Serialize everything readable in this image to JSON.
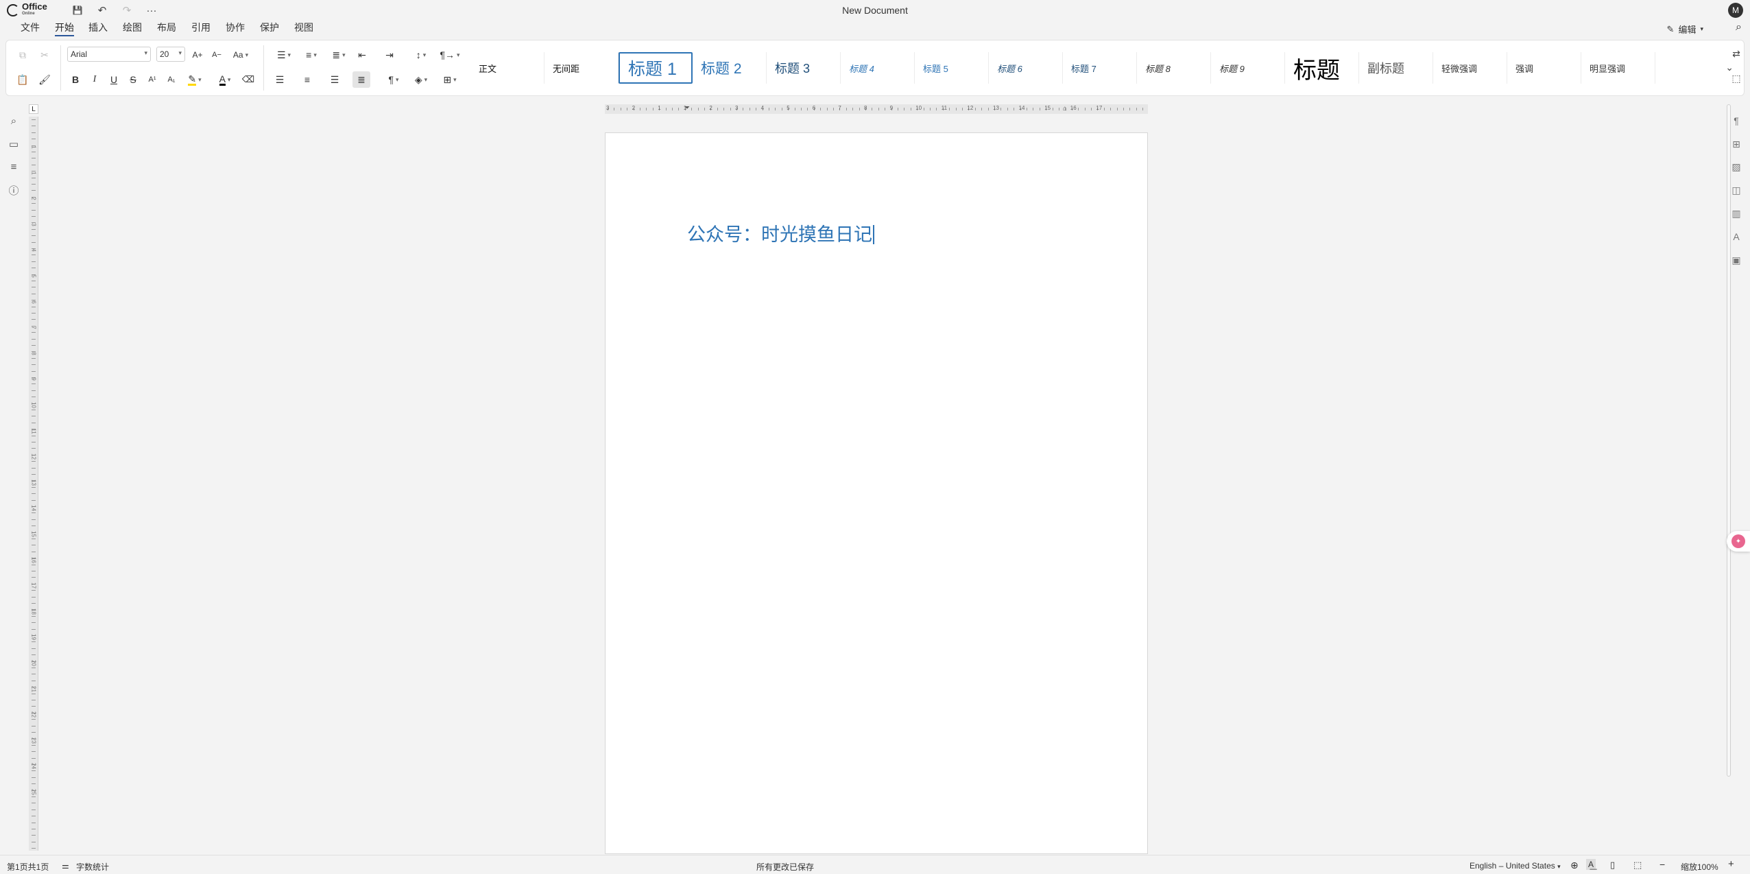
{
  "app": {
    "logo": "Office",
    "logo_sub": "Online",
    "doc_title": "New Document",
    "avatar": "M"
  },
  "quick": {
    "save": "💾",
    "undo": "↶",
    "redo": "↷",
    "more": "···"
  },
  "menu": {
    "items": [
      "文件",
      "开始",
      "插入",
      "绘图",
      "布局",
      "引用",
      "协作",
      "保护",
      "视图"
    ],
    "active": 1,
    "edit_mode": "编辑",
    "edit_icon": "✎",
    "search_icon": "⌕"
  },
  "ribbon": {
    "font_name": "Arial",
    "font_size": "20",
    "grow": "A+",
    "shrink": "A−",
    "case": "Aa",
    "bold": "B",
    "italic": "I",
    "underline": "U",
    "strike": "S",
    "superscript": "A¹",
    "subscript": "A₁",
    "highlight": "✎",
    "font_color": "A",
    "eraser": "⌫",
    "para_mark": "¶",
    "highlight_color": "#ffd800",
    "font_color_bar": "#000000"
  },
  "styles": [
    {
      "label": "正文",
      "cls": "st-normal"
    },
    {
      "label": "无间距",
      "cls": "st-normal"
    },
    {
      "label": "标题 1",
      "cls": "st-h1"
    },
    {
      "label": "标题 2",
      "cls": "st-h2"
    },
    {
      "label": "标题 3",
      "cls": "st-h3"
    },
    {
      "label": "标题 4",
      "cls": "st-h4"
    },
    {
      "label": "标题 5",
      "cls": "st-h5"
    },
    {
      "label": "标题 6",
      "cls": "st-h6"
    },
    {
      "label": "标题 7",
      "cls": "st-h7"
    },
    {
      "label": "标题 8",
      "cls": "st-h8"
    },
    {
      "label": "标题 9",
      "cls": "st-h9"
    },
    {
      "label": "标题",
      "cls": "st-title"
    },
    {
      "label": "副标题",
      "cls": "st-sub"
    },
    {
      "label": "轻微强调",
      "cls": "st-emph"
    },
    {
      "label": "强调",
      "cls": "st-emph"
    },
    {
      "label": "明显强调",
      "cls": "st-emph"
    }
  ],
  "selected_style": 2,
  "document": {
    "heading": "公众号：时光摸鱼日记"
  },
  "hruler_labels": [
    "3",
    "2",
    "1",
    "1",
    "2",
    "3",
    "4",
    "5",
    "6",
    "7",
    "8",
    "9",
    "10",
    "11",
    "12",
    "13",
    "14",
    "15",
    "16",
    "17"
  ],
  "vruler_labels": [
    "1",
    "1",
    "2",
    "3",
    "4",
    "5",
    "6",
    "7",
    "8",
    "9",
    "10",
    "11",
    "12",
    "13",
    "14",
    "15",
    "16",
    "17",
    "18",
    "19",
    "20",
    "21",
    "22",
    "23",
    "24",
    "25"
  ],
  "status": {
    "page": "第1页共1页",
    "word_count": "字数统计",
    "saved": "所有更改已保存",
    "language": "English – United States",
    "zoom": "缩放100%",
    "zoom_out": "−",
    "zoom_in": "+"
  }
}
